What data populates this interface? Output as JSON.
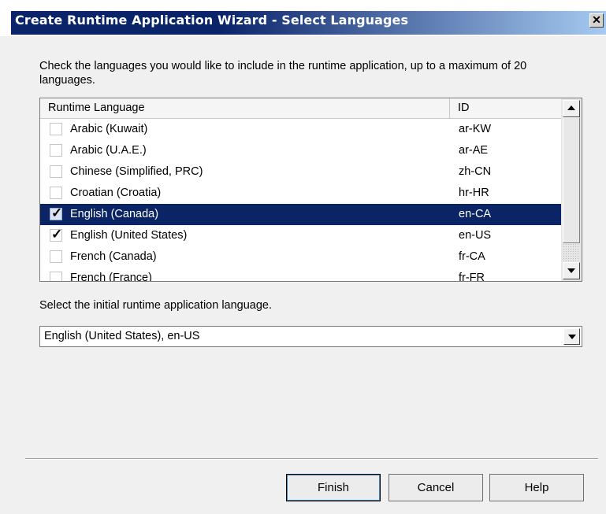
{
  "window": {
    "title": "Create Runtime Application Wizard - Select Languages",
    "close_glyph": "✕",
    "title_gradient": [
      "#0a246a",
      "#a6caf0"
    ]
  },
  "instruction": "Check the languages you would like to include in the runtime application, up to a maximum of 20 languages.",
  "language_list": {
    "columns": [
      "Runtime Language",
      "ID"
    ],
    "rows": [
      {
        "label": "Arabic (Kuwait)",
        "id": "ar-KW",
        "checked": false,
        "selected": false
      },
      {
        "label": "Arabic (U.A.E.)",
        "id": "ar-AE",
        "checked": false,
        "selected": false
      },
      {
        "label": "Chinese (Simplified, PRC)",
        "id": "zh-CN",
        "checked": false,
        "selected": false
      },
      {
        "label": "Croatian (Croatia)",
        "id": "hr-HR",
        "checked": false,
        "selected": false
      },
      {
        "label": "English (Canada)",
        "id": "en-CA",
        "checked": true,
        "selected": true
      },
      {
        "label": "English (United States)",
        "id": "en-US",
        "checked": true,
        "selected": false
      },
      {
        "label": "French (Canada)",
        "id": "fr-CA",
        "checked": false,
        "selected": false
      },
      {
        "label": "French (France)",
        "id": "fr-FR",
        "checked": false,
        "selected": false
      }
    ]
  },
  "initial_language": {
    "label": "Select the initial runtime application language.",
    "selected_value": "English (United States), en-US"
  },
  "buttons": {
    "finish": "Finish",
    "cancel": "Cancel",
    "help": "Help"
  },
  "colors": {
    "selection": "#0a2466",
    "dialog_bg": "#f0f0f0"
  }
}
